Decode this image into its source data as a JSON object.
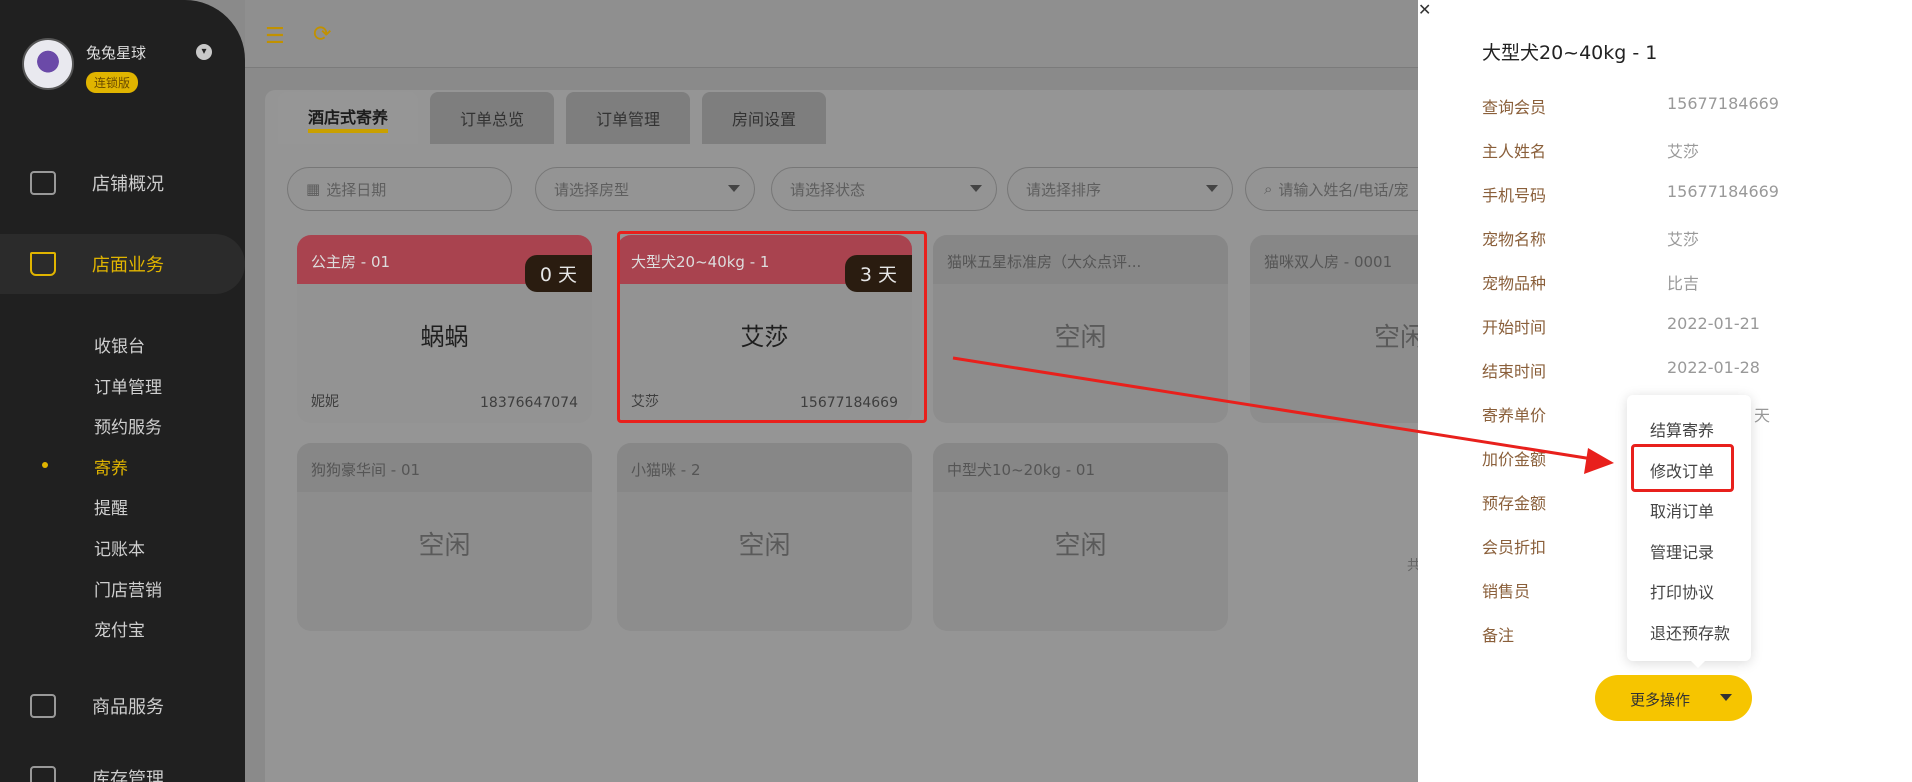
{
  "sidebar": {
    "store_name": "兔兔星球",
    "edition": "连锁版",
    "nav": [
      {
        "label": "店铺概况"
      },
      {
        "label": "店面业务"
      },
      {
        "label": "商品服务"
      },
      {
        "label": "库存管理"
      }
    ],
    "sub": [
      "收银台",
      "订单管理",
      "预约服务",
      "寄养",
      "提醒",
      "记账本",
      "门店营销",
      "宠付宝"
    ]
  },
  "tabs": [
    "酒店式寄养",
    "订单总览",
    "订单管理",
    "房间设置"
  ],
  "filters": {
    "date": "选择日期",
    "room_type": "请选择房型",
    "status": "请选择状态",
    "sort": "请选择排序",
    "search": "请输入姓名/电话/宠"
  },
  "rooms": [
    {
      "title": "公主房 - 01",
      "days": "0 天",
      "pet": "蜗蜗",
      "owner": "妮妮",
      "phone": "18376647074",
      "occupied": true
    },
    {
      "title": "大型犬20~40kg - 1",
      "days": "3 天",
      "pet": "艾莎",
      "owner": "艾莎",
      "phone": "15677184669",
      "occupied": true
    },
    {
      "title": "猫咪五星标准房（大众点评...",
      "status": "空闲"
    },
    {
      "title": "猫咪双人房 - 0001",
      "status": "空闲"
    },
    {
      "title": "狗狗豪华间 - 01",
      "status": "空闲"
    },
    {
      "title": "小猫咪 - 2",
      "status": "空闲"
    },
    {
      "title": "中型犬10~20kg - 01",
      "status": "空闲"
    }
  ],
  "peek_text": "共",
  "panel": {
    "title": "大型犬20~40kg - 1",
    "fields": [
      {
        "label": "查询会员",
        "value": "15677184669"
      },
      {
        "label": "主人姓名",
        "value": "艾莎"
      },
      {
        "label": "手机号码",
        "value": "15677184669"
      },
      {
        "label": "宠物名称",
        "value": "艾莎"
      },
      {
        "label": "宠物品种",
        "value": "比吉"
      },
      {
        "label": "开始时间",
        "value": "2022-01-21"
      },
      {
        "label": "结束时间",
        "value": "2022-01-28"
      },
      {
        "label": "寄养单价",
        "value": "天"
      },
      {
        "label": "加价金额",
        "value": ""
      },
      {
        "label": "预存金额",
        "value": ""
      },
      {
        "label": "会员折扣",
        "value": ""
      },
      {
        "label": "销售员",
        "value": ""
      },
      {
        "label": "备注",
        "value": ""
      }
    ],
    "dropdown": [
      "结算寄养",
      "修改订单",
      "取消订单",
      "管理记录",
      "打印协议",
      "退还预存款"
    ],
    "more_button": "更多操作"
  },
  "colors": {
    "accent": "#f6c500",
    "highlight": "#e8201c",
    "occupied_header": "#a9434f"
  }
}
